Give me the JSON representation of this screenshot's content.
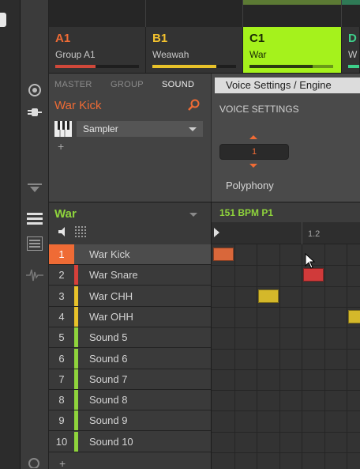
{
  "groups": [
    {
      "id": "A1",
      "name": "Group A1",
      "color": "#ef6b35",
      "bar_color": "#d0483a",
      "bar_level": 0.48,
      "active": false
    },
    {
      "id": "B1",
      "name": "Weawah",
      "color": "#f2c12e",
      "bar_color": "#e8c22a",
      "bar_level": 0.76,
      "active": false
    },
    {
      "id": "C1",
      "name": "War",
      "color": "#1a2a05",
      "bar_color": "#2a3a10",
      "bar_level": 0.75,
      "active": true,
      "active_bg": "#a5f21c"
    },
    {
      "id": "D",
      "name": "W",
      "color": "#3ecf8a",
      "bar_color": "#3ecf8a",
      "bar_level": 0.5,
      "active": false
    }
  ],
  "plugin_panel": {
    "level_tabs": [
      "MASTER",
      "GROUP",
      "SOUND"
    ],
    "active_tab": "SOUND",
    "sound_name": "War Kick",
    "plugin_name": "Sampler",
    "add_label": "+"
  },
  "params": {
    "page_label": "Voice Settings / Engine",
    "section_title": "VOICE SETTINGS",
    "polyphony_value": "1",
    "polyphony_label": "Polyphony"
  },
  "pattern": {
    "group_title": "War",
    "bpm_label": "151 BPM P1",
    "ruler_label": "1.2",
    "add_label": "+"
  },
  "sounds": [
    {
      "num": "1",
      "name": "War Kick",
      "color": "#ef6b35",
      "selected": true
    },
    {
      "num": "2",
      "name": "War Snare",
      "color": "#d6403a",
      "selected": false
    },
    {
      "num": "3",
      "name": "War CHH",
      "color": "#e8c22a",
      "selected": false
    },
    {
      "num": "4",
      "name": "War OHH",
      "color": "#e8c22a",
      "selected": false
    },
    {
      "num": "5",
      "name": "Sound 5",
      "color": "#8fd43c",
      "selected": false
    },
    {
      "num": "6",
      "name": "Sound 6",
      "color": "#8fd43c",
      "selected": false
    },
    {
      "num": "7",
      "name": "Sound 7",
      "color": "#8fd43c",
      "selected": false
    },
    {
      "num": "8",
      "name": "Sound 8",
      "color": "#8fd43c",
      "selected": false
    },
    {
      "num": "9",
      "name": "Sound 9",
      "color": "#8fd43c",
      "selected": false
    },
    {
      "num": "10",
      "name": "Sound 10",
      "color": "#8fd43c",
      "selected": false
    }
  ],
  "notes": [
    {
      "row": 0,
      "step": 0,
      "color": "#d9673a"
    },
    {
      "row": 1,
      "step": 4,
      "color": "#d03a3a"
    },
    {
      "row": 2,
      "step": 2,
      "color": "#d4b82a"
    },
    {
      "row": 3,
      "step": 6,
      "color": "#d4b82a"
    }
  ]
}
